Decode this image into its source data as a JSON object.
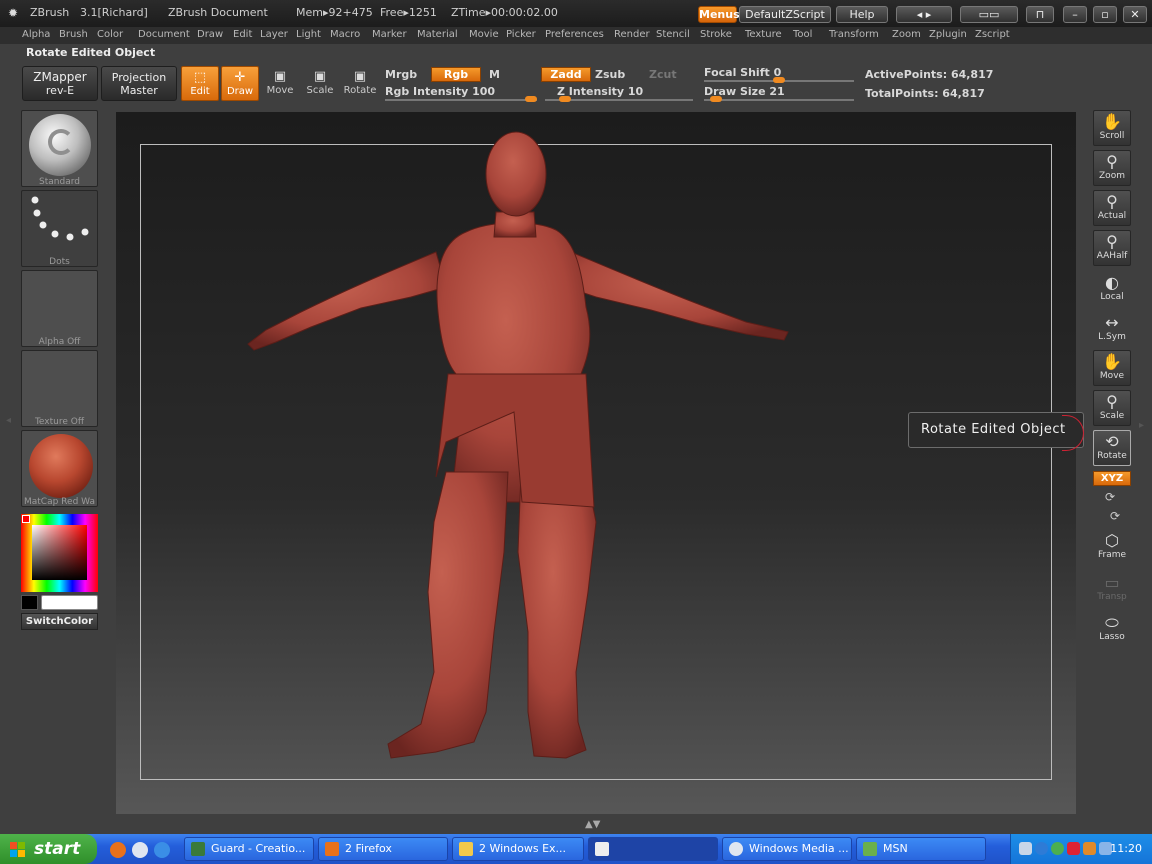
{
  "titlebar": {
    "app_name": "ZBrush",
    "version": "3.1[Richard]",
    "document": "ZBrush Document",
    "mem": "Mem▸92+475",
    "free": "Free▸1251",
    "ztime": "ZTime▸00:00:02.00",
    "menus_label": "Menus",
    "script_label": "DefaultZScript",
    "help_label": "Help"
  },
  "menu": {
    "items": [
      "Alpha",
      "Brush",
      "Color",
      "Document",
      "Draw",
      "Edit",
      "Layer",
      "Light",
      "Macro",
      "Marker",
      "Material",
      "Movie",
      "Picker",
      "Preferences",
      "Render",
      "Stencil",
      "Stroke",
      "Texture",
      "Tool",
      "Transform",
      "Zoom",
      "Zplugin",
      "Zscript"
    ]
  },
  "command_label": "Rotate Edited Object",
  "toolbar": {
    "zmapper_line1": "ZMapper",
    "zmapper_line2": "rev-E",
    "projection_line1": "Projection",
    "projection_line2": "Master",
    "edit_label": "Edit",
    "draw_label": "Draw",
    "move_label": "Move",
    "scale_label": "Scale",
    "rotate_label": "Rotate",
    "mrgb_label": "Mrgb",
    "rgb_label": "Rgb",
    "m_label": "M",
    "rgb_intensity_label": "Rgb Intensity 100",
    "rgb_intensity_value": 100,
    "zadd_label": "Zadd",
    "zsub_label": "Zsub",
    "zcut_label": "Zcut",
    "z_intensity_label": "Z Intensity 10",
    "z_intensity_value": 10,
    "focal_shift_label": "Focal Shift 0",
    "focal_shift_value": 0,
    "draw_size_label": "Draw Size 21",
    "draw_size_value": 21,
    "active_points": "ActivePoints: 64,817",
    "total_points": "TotalPoints: 64,817"
  },
  "left_shelf": {
    "brush_caption": "Standard",
    "stroke_caption": "Dots",
    "alpha_caption": "Alpha Off",
    "texture_caption": "Texture Off",
    "material_caption": "MatCap Red Wa",
    "switch_color": "SwitchColor"
  },
  "right_shelf": {
    "scroll": "Scroll",
    "zoom": "Zoom",
    "actual": "Actual",
    "aahalf": "AAHalf",
    "local": "Local",
    "lsym": "L.Sym",
    "move": "Move",
    "scale": "Scale",
    "rotate": "Rotate",
    "xyz": "XYZ",
    "frame": "Frame",
    "transp": "Transp",
    "lasso": "Lasso"
  },
  "tooltip": "Rotate Edited Object",
  "taskbar": {
    "start": "start",
    "tasks": [
      "Guard - Creatio...",
      "2 Firefox",
      "2 Windows Ex...",
      "",
      "Windows Media ...",
      "MSN"
    ],
    "clock": "11:20"
  },
  "colors": {
    "accent": "#e87c1a",
    "sculpt": "#a8453a",
    "material": "#b8472f"
  }
}
